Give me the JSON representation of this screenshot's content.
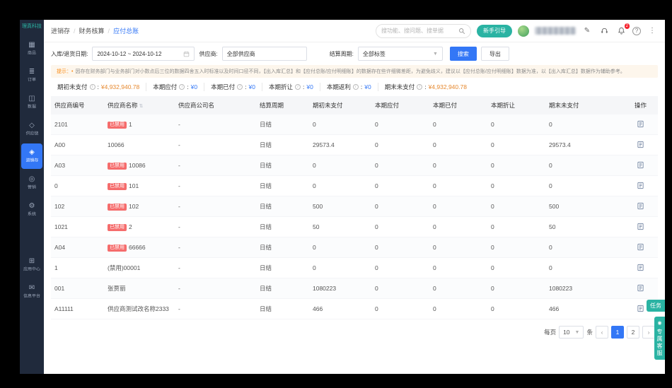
{
  "colors": {
    "accent": "#3377f6",
    "teal": "#2ab3a3",
    "danger": "#f56c6c",
    "warn_bg": "#fdf6ec",
    "amount": "#e6882e",
    "sidebar_bg": "#202a3c"
  },
  "sidebar": {
    "logo": "理真科技",
    "items": [
      {
        "label": "商品",
        "icon": "goods-icon",
        "active": false
      },
      {
        "label": "订单",
        "icon": "orders-icon",
        "active": false
      },
      {
        "label": "数据",
        "icon": "data-icon",
        "active": false
      },
      {
        "label": "供应链",
        "icon": "supply-icon",
        "active": false
      },
      {
        "label": "进销存",
        "icon": "inventory-icon",
        "active": true
      },
      {
        "label": "营销",
        "icon": "marketing-icon",
        "active": false
      },
      {
        "label": "系统",
        "icon": "system-icon",
        "active": false
      }
    ],
    "bottom_items": [
      {
        "label": "应用中心",
        "icon": "apps-icon",
        "active": false
      },
      {
        "label": "信息平台",
        "icon": "platform-icon",
        "active": false
      }
    ]
  },
  "header": {
    "breadcrumb": [
      "进销存",
      "财务核算",
      "应付总账"
    ],
    "crumb_sep": "/",
    "search_placeholder": "搜功能、搜问题、搜单据",
    "guide_button": "新手引导",
    "bell_badge": "2",
    "help_label": "?"
  },
  "filters": {
    "date_label": "入库/退货日期:",
    "date_value": "2024-10-12 ~ 2024-10-12",
    "supplier_label": "供应商:",
    "supplier_value": "全部供应商",
    "cycle_label": "结算周期:",
    "cycle_value": "全部标签",
    "search_button": "搜索",
    "export_button": "导出"
  },
  "notice": {
    "prefix": "提示：•",
    "text": "因存在财务部门与业务部门对小数点后三位的数据四舍五入时标准以及时间口径不同，【出入库汇总】和【应付总账/应付明细账】的数据存在些许细微差距，为避免歧义，建议以【应付总账/应付明细账】数据为准，以【出入库汇总】数据作为辅助参考。"
  },
  "summary": {
    "colon": ":",
    "items": [
      {
        "label": "期初未支付",
        "value": "¥4,932,940.78",
        "highlight": true
      },
      {
        "label": "本期应付",
        "value": "¥0",
        "highlight": false
      },
      {
        "label": "本期已付",
        "value": "¥0",
        "highlight": false
      },
      {
        "label": "本期折让",
        "value": "¥0",
        "highlight": false
      },
      {
        "label": "本期返利",
        "value": "¥0",
        "highlight": false
      },
      {
        "label": "期末未支付",
        "value": "¥4,932,940.78",
        "highlight": true
      }
    ]
  },
  "table": {
    "headers": [
      "供应商编号",
      "供应商名称",
      "供应商公司名",
      "结算周期",
      "期初未支付",
      "本期应付",
      "本期已付",
      "本期折让",
      "期末未支付",
      "操作"
    ],
    "disabled_badge": "已禁用",
    "rows": [
      {
        "no": "2101",
        "name": "1",
        "disabled": true,
        "company": "-",
        "cycle": "日结",
        "begin": "0",
        "payable": "0",
        "paid": "0",
        "discount": "0",
        "end": "0"
      },
      {
        "no": "A00",
        "name": "10066",
        "disabled": false,
        "company": "-",
        "cycle": "日结",
        "begin": "29573.4",
        "payable": "0",
        "paid": "0",
        "discount": "0",
        "end": "29573.4"
      },
      {
        "no": "A03",
        "name": "10086",
        "disabled": true,
        "company": "-",
        "cycle": "日结",
        "begin": "0",
        "payable": "0",
        "paid": "0",
        "discount": "0",
        "end": "0"
      },
      {
        "no": "0",
        "name": "101",
        "disabled": true,
        "company": "-",
        "cycle": "日结",
        "begin": "0",
        "payable": "0",
        "paid": "0",
        "discount": "0",
        "end": "0"
      },
      {
        "no": "102",
        "name": "102",
        "disabled": true,
        "company": "-",
        "cycle": "日结",
        "begin": "500",
        "payable": "0",
        "paid": "0",
        "discount": "0",
        "end": "500"
      },
      {
        "no": "1021",
        "name": "2",
        "disabled": true,
        "company": "-",
        "cycle": "日结",
        "begin": "50",
        "payable": "0",
        "paid": "0",
        "discount": "0",
        "end": "50"
      },
      {
        "no": "A04",
        "name": "66666",
        "disabled": true,
        "company": "-",
        "cycle": "日结",
        "begin": "0",
        "payable": "0",
        "paid": "0",
        "discount": "0",
        "end": "0"
      },
      {
        "no": "1",
        "name": "(禁用)00001",
        "disabled": false,
        "company": "-",
        "cycle": "日结",
        "begin": "0",
        "payable": "0",
        "paid": "0",
        "discount": "0",
        "end": "0"
      },
      {
        "no": "001",
        "name": "张贾丽",
        "disabled": false,
        "company": "-",
        "cycle": "日结",
        "begin": "1080223",
        "payable": "0",
        "paid": "0",
        "discount": "0",
        "end": "1080223"
      },
      {
        "no": "A11111",
        "name": "供应商测试改名称2333",
        "disabled": false,
        "company": "-",
        "cycle": "日结",
        "begin": "466",
        "payable": "0",
        "paid": "0",
        "discount": "0",
        "end": "466"
      }
    ]
  },
  "pagination": {
    "per_page_label": "每页",
    "per_page": "10",
    "unit": "条",
    "prev_icon": "‹",
    "next_icon": "›",
    "pages": [
      {
        "label": "1",
        "active": true
      },
      {
        "label": "2",
        "active": false
      }
    ]
  },
  "floating": {
    "task_label": "任务",
    "service_label": "专属客服"
  }
}
